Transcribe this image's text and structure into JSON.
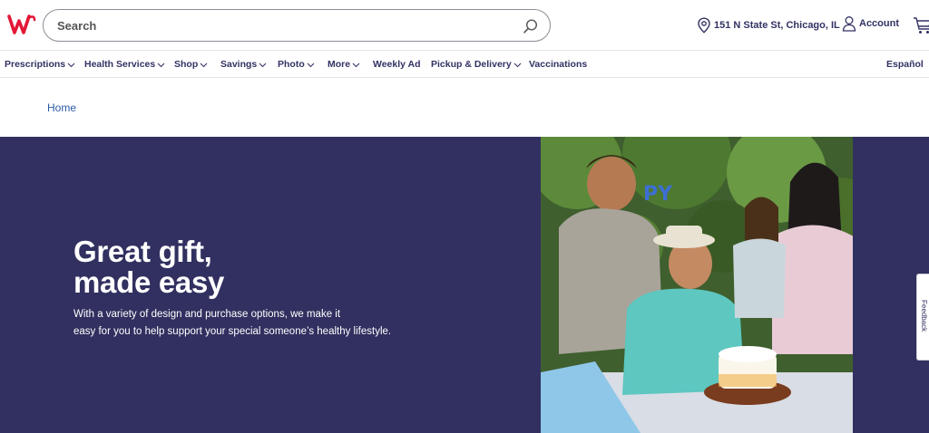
{
  "header": {
    "logo_alt": "Walgreens",
    "search_placeholder": "Search",
    "store_address": "151 N State St, Chicago, IL",
    "account_label": "Account"
  },
  "nav": {
    "items": [
      {
        "label": "Prescriptions",
        "has_dropdown": true
      },
      {
        "label": "Health Services",
        "has_dropdown": true
      },
      {
        "label": "Shop",
        "has_dropdown": true
      },
      {
        "label": "Savings",
        "has_dropdown": true
      },
      {
        "label": "Photo",
        "has_dropdown": true
      },
      {
        "label": "More",
        "has_dropdown": true
      },
      {
        "label": "Weekly Ad",
        "has_dropdown": false
      },
      {
        "label": "Pickup & Delivery",
        "has_dropdown": true
      },
      {
        "label": "Vaccinations",
        "has_dropdown": false
      }
    ],
    "language": "Español"
  },
  "breadcrumb": {
    "label": "Home"
  },
  "hero": {
    "title_line1": "Great gift,",
    "title_line2": "made easy",
    "body_line1": "With a variety of design and purchase options, we make it",
    "body_line2": "easy for you to help support your special someone’s healthy lifestyle.",
    "photo_banner": "PY"
  },
  "feedback": {
    "label": "Feedback"
  },
  "colors": {
    "brand_red": "#e31837",
    "navy": "#323264",
    "hero_bg": "#313060",
    "link_blue": "#2b5aa6"
  },
  "icons": {
    "search": "magnifier-icon",
    "location": "location-pin-icon",
    "account": "person-icon",
    "cart": "cart-icon",
    "chevron": "chevron-down-icon"
  }
}
